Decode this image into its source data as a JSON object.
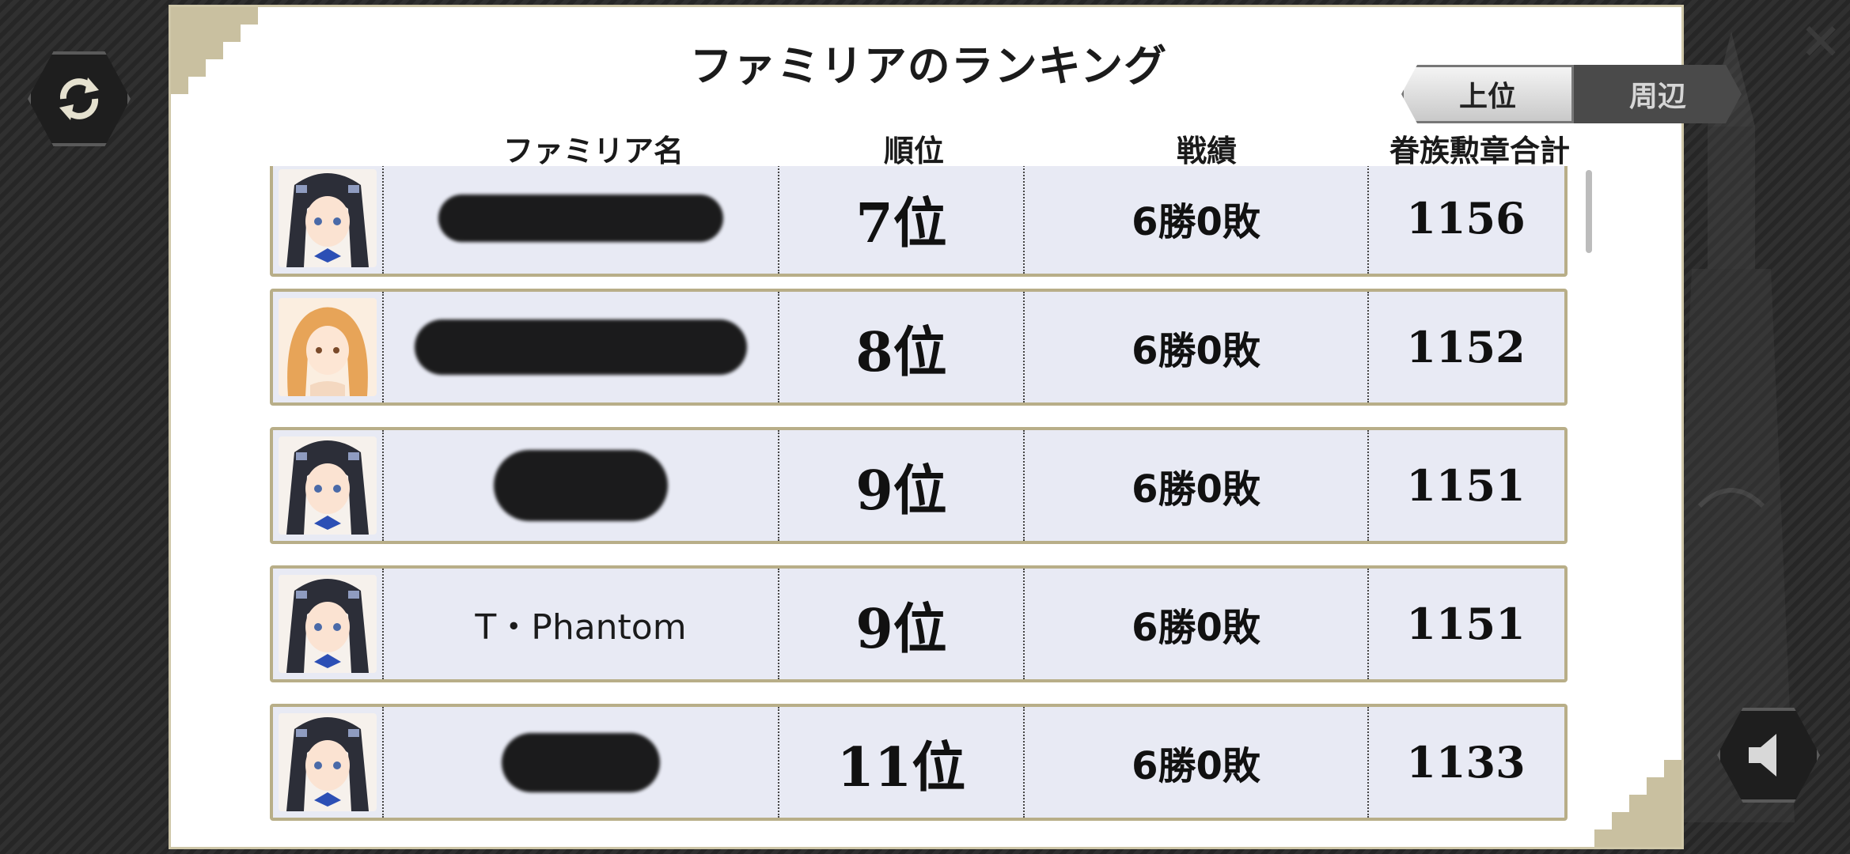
{
  "header": {
    "title": "ファミリアのランキング",
    "tabs": [
      {
        "label": "上位",
        "active": false
      },
      {
        "label": "周辺",
        "active": true
      }
    ],
    "close_icon": "close-icon"
  },
  "columns": [
    "ファミリア名",
    "順位",
    "戦績",
    "眷族勲章合計"
  ],
  "rows": [
    {
      "avatar": "hestia-portrait",
      "name": "",
      "name_redacted": true,
      "rank": "7位",
      "record": "6勝0敗",
      "medals": "1156"
    },
    {
      "avatar": "blonde-portrait",
      "name": "",
      "name_redacted": true,
      "rank": "8位",
      "record": "6勝0敗",
      "medals": "1152"
    },
    {
      "avatar": "hestia-portrait",
      "name": "",
      "name_redacted": true,
      "rank": "9位",
      "record": "6勝0敗",
      "medals": "1151"
    },
    {
      "avatar": "hestia-portrait",
      "name": "T・Phantom",
      "name_redacted": false,
      "rank": "9位",
      "record": "6勝0敗",
      "medals": "1151"
    },
    {
      "avatar": "hestia-portrait",
      "name": "",
      "name_redacted": true,
      "rank": "11位",
      "record": "6勝0敗",
      "medals": "1133"
    }
  ],
  "side_buttons": {
    "left": "refresh-icon",
    "right": "speaker-icon"
  },
  "colors": {
    "row_bg": "#e8eaf4",
    "row_border": "#b8ae88",
    "panel_bg": "#ffffff"
  }
}
